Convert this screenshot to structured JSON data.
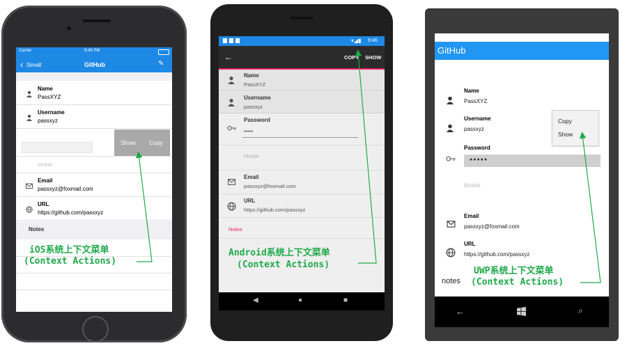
{
  "ios": {
    "status": {
      "carrier": "Carrier",
      "time": "9:45 PM"
    },
    "nav": {
      "back_label": "Small",
      "title": "GitHub"
    },
    "fields": [
      {
        "label": "Name",
        "value": "PassXYZ",
        "icon": "person-icon"
      },
      {
        "label": "Username",
        "value": "passxyz",
        "icon": "person-icon"
      },
      {
        "label": "Email",
        "value": "passxyz@foxmail.com",
        "icon": "mail-icon"
      },
      {
        "label": "URL",
        "value": "https://github.com/passxyz",
        "icon": "globe-icon"
      }
    ],
    "mobile_placeholder": "Mobile",
    "notes_label": "Notes",
    "context_actions": [
      "Show",
      "Copy"
    ]
  },
  "android": {
    "status": {
      "time": "9:46"
    },
    "toolbar": {
      "copy_label": "COPY",
      "show_label": "SHOW"
    },
    "fields": [
      {
        "label": "Name",
        "value": "PassXYZ",
        "icon": "person-icon"
      },
      {
        "label": "Username",
        "value": "passxyz",
        "icon": "person-icon"
      },
      {
        "label": "Password",
        "value": "•••••",
        "icon": "key-icon"
      },
      {
        "label": "Email",
        "value": "passxyz@foxmail.com",
        "icon": "mail-icon"
      },
      {
        "label": "URL",
        "value": "https://github.com/passxyz",
        "icon": "globe-icon"
      }
    ],
    "mobile_placeholder": "Mobile",
    "notes_label": "Notes",
    "notes_color": "#e91e63"
  },
  "uwp": {
    "header_title": "GitHub",
    "fields": [
      {
        "label": "Name",
        "value": "PassXYZ",
        "icon": "person-icon"
      },
      {
        "label": "Username",
        "value": "passxyz",
        "icon": "person-icon"
      },
      {
        "label": "Password",
        "value": "●●●●●",
        "icon": "key-icon"
      },
      {
        "label": "Email",
        "value": "passxyz@foxmail.com",
        "icon": "mail-icon"
      },
      {
        "label": "URL",
        "value": "https://github.com/passxyz",
        "icon": "globe-icon"
      }
    ],
    "mobile_placeholder": "Mobile",
    "notes_label": "notes",
    "context_menu": [
      "Copy",
      "Show"
    ]
  },
  "captions": {
    "ios_line1": "iOS系统上下文菜单",
    "ios_line2": "(Context Actions)",
    "android_line1": "Android系统上下文菜单",
    "android_line2": "(Context Actions)",
    "uwp_line1": "UWP系统上下文菜单",
    "uwp_line2": "(Context Actions)"
  },
  "colors": {
    "ios_blue": "#1e88e5",
    "android_blue": "#1e88e5",
    "uwp_blue": "#2196f3",
    "caption_green": "#1fa94a"
  }
}
